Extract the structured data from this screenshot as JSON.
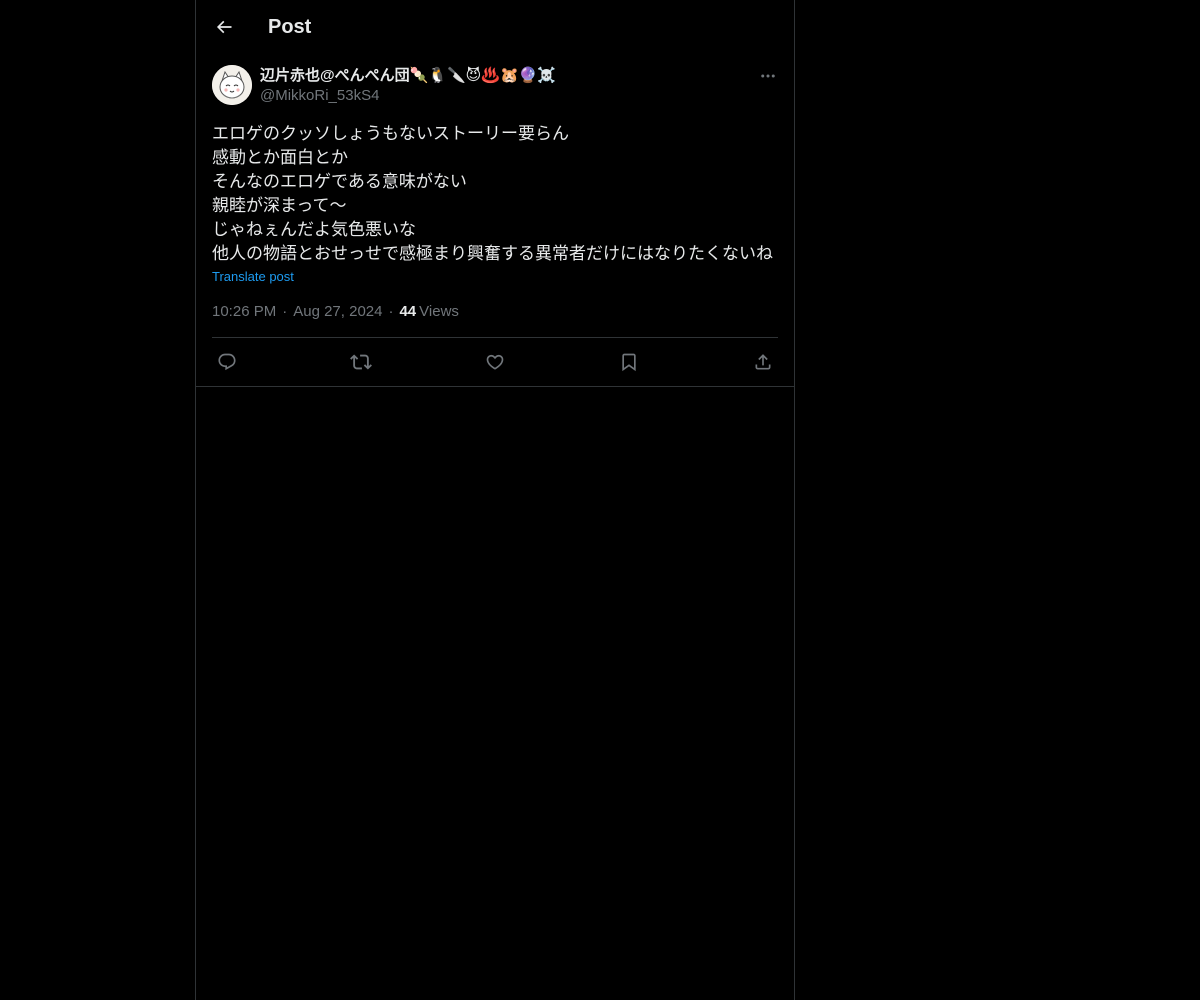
{
  "header": {
    "title": "Post",
    "back_icon": "arrow-left-icon"
  },
  "post": {
    "display_name": "辺片赤也@ぺんぺん団🍡🐧🔪😈♨️🐹🔮☠️",
    "handle": "@MikkoRi_53kS4",
    "text": "エロゲのクッソしょうもないストーリー要らん\n感動とか面白とか\nそんなのエロゲである意味がない\n親睦が深まって〜\nじゃねぇんだよ気色悪いな\n他人の物語とおせっせで感極まり興奮する異常者だけにはなりたくないね",
    "translate_label": "Translate post",
    "time": "10:26 PM",
    "date": "Aug 27, 2024",
    "separator": "·",
    "views_count": "44",
    "views_label": "Views"
  },
  "actions": {
    "reply_icon": "reply-icon",
    "repost_icon": "repost-icon",
    "like_icon": "heart-icon",
    "bookmark_icon": "bookmark-icon",
    "share_icon": "share-icon"
  },
  "colors": {
    "background": "#000000",
    "text_primary": "#e7e9ea",
    "text_secondary": "#71767b",
    "link": "#1d9bf0",
    "border": "#2f3336"
  }
}
